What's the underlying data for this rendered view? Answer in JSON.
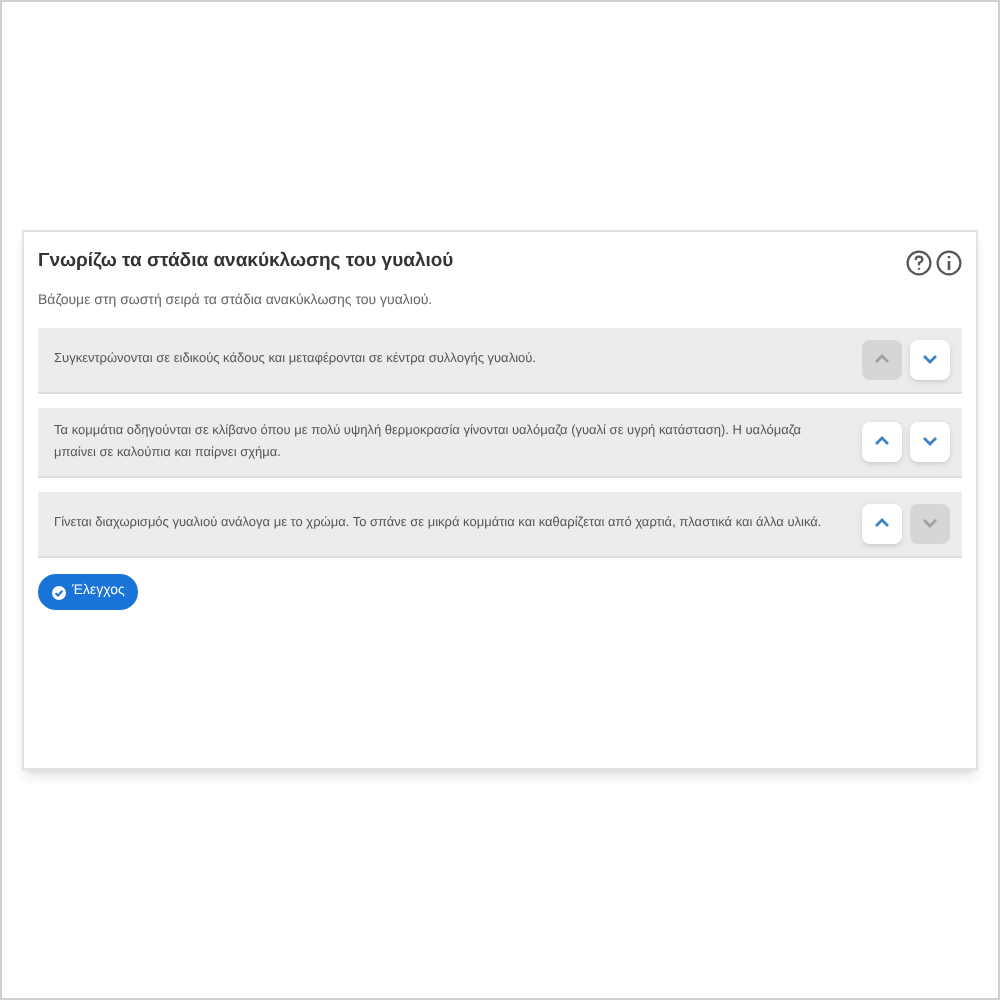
{
  "title": "Γνωρίζω τα στάδια ανακύκλωσης του γυαλιού",
  "instruction": "Βάζουμε στη σωστή σειρά τα στάδια ανακύκλωσης του γυαλιού.",
  "items": [
    {
      "text": "Συγκεντρώνονται σε ειδικούς κάδους και μεταφέρονται σε κέντρα συλλογής γυαλιού.",
      "up_disabled": true,
      "down_disabled": false
    },
    {
      "text": "Τα κομμάτια οδηγούνται σε κλίβανο όπου με πολύ υψηλή θερμοκρασία γίνονται υαλόμαζα (γυαλί σε υγρή κατάσταση). Η υαλόμαζα μπαίνει σε καλούπια και παίρνει σχήμα.",
      "up_disabled": false,
      "down_disabled": false
    },
    {
      "text": "Γίνεται διαχωρισμός γυαλιού ανάλογα με το χρώμα. Το σπάνε σε μικρά κομμάτια και καθαρίζεται από χαρτιά, πλαστικά και άλλα υλικά.",
      "up_disabled": false,
      "down_disabled": true
    }
  ],
  "check_button": "Έλεγχος"
}
